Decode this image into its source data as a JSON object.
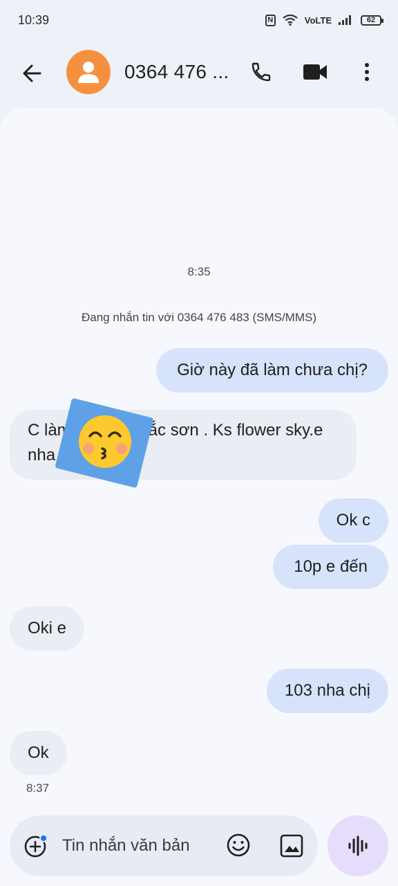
{
  "status_bar": {
    "time": "10:39",
    "nfc": "N",
    "network": "VoLTE",
    "battery": "62"
  },
  "header": {
    "contact_name": "0364 476 ...",
    "icons": [
      "back-arrow-icon",
      "person-icon",
      "phone-icon",
      "video-icon",
      "more-vert-icon"
    ]
  },
  "conversation": {
    "timestamp_top": "8:35",
    "info": "Đang nhắn tin với 0364 476 483 (SMS/MMS)",
    "messages": [
      {
        "dir": "out",
        "text": "Giờ này đã làm chưa chị?"
      },
      {
        "dir": "in",
        "line1": "C làm",
        "line1b": "ắc sơn . Ks flower sky.e",
        "line2": "nha"
      },
      {
        "dir": "out",
        "text": "Ok c"
      },
      {
        "dir": "out",
        "text": "10p e đến"
      },
      {
        "dir": "in",
        "text": "Oki e"
      },
      {
        "dir": "out",
        "text": "103 nha chị"
      },
      {
        "dir": "in",
        "text": "Ok"
      }
    ],
    "timestamp_bottom": "8:37"
  },
  "composer": {
    "placeholder": "Tin nhắn văn bản",
    "icons": [
      "add-icon",
      "emoji-icon",
      "gallery-icon",
      "voice-wave-icon"
    ]
  },
  "colors": {
    "avatar": "#f5913e",
    "outgoing_bubble": "#d6e3fb",
    "incoming_bubble": "#eaedf3",
    "voice_button": "#e6dcfb",
    "sticker_bg": "#5ea1e6"
  }
}
